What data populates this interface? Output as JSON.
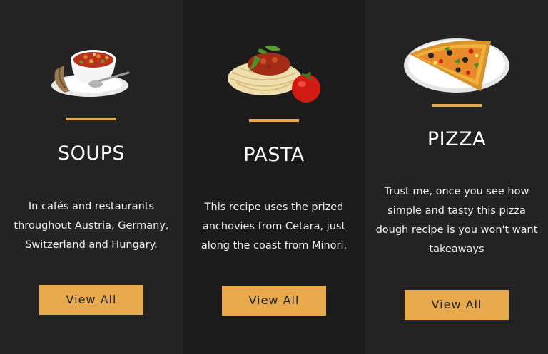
{
  "cards": [
    {
      "icon": "soup-bowl-icon",
      "title": "SOUPS",
      "description": "In cafés and restaurants throughout Austria, Germany, Switzerland and Hungary.",
      "button": "View All"
    },
    {
      "icon": "pasta-plate-icon",
      "title": "PASTA",
      "description": "This recipe uses the prized anchovies from Cetara, just along the coast from Minori.",
      "button": "View All"
    },
    {
      "icon": "pizza-slice-icon",
      "title": "PIZZA",
      "description": "Trust me, once you see how simple and tasty this pizza dough recipe is you won't want takeaways",
      "button": "View All"
    }
  ],
  "colors": {
    "accent": "#e8a94c",
    "panel_light": "#232323",
    "panel_dark": "#1b1b1b"
  }
}
